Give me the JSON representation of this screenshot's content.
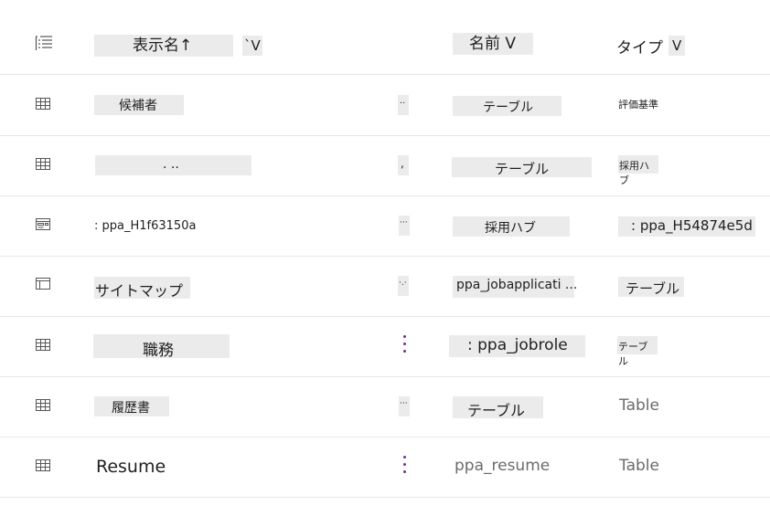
{
  "header": {
    "col_display": "表示名↑",
    "col_display_sort": "`V",
    "col_name": "名前 V",
    "col_type": "タイプ",
    "col_type_sort": "V"
  },
  "rows": [
    {
      "icon": "table-icon",
      "display": "候補者",
      "more": "··",
      "name": "テーブル",
      "type": "評価基準"
    },
    {
      "icon": "table-icon",
      "display": ". ..",
      "more": ",",
      "name": "テーブル",
      "type": "採用ハブ"
    },
    {
      "icon": "form-icon",
      "display": ": ppa_H1f63150a",
      "more": "···",
      "name": "採用ハブ",
      "type": ": ppa_H54874e5d"
    },
    {
      "icon": "sitemap-icon",
      "display": "サイトマップ",
      "more": "·.·",
      "name": "ppa_jobapplicati ...",
      "type": "テーブル"
    },
    {
      "icon": "table-icon",
      "display": "職務",
      "more": "",
      "name": ": ppa_jobrole",
      "type": "テーブル"
    },
    {
      "icon": "table-icon",
      "display": "履歴書",
      "more": "···",
      "name": "テーブル",
      "type": "Table"
    },
    {
      "icon": "table-icon",
      "display": "Resume",
      "more": "",
      "name": "ppa_resume",
      "type": "Table"
    }
  ]
}
